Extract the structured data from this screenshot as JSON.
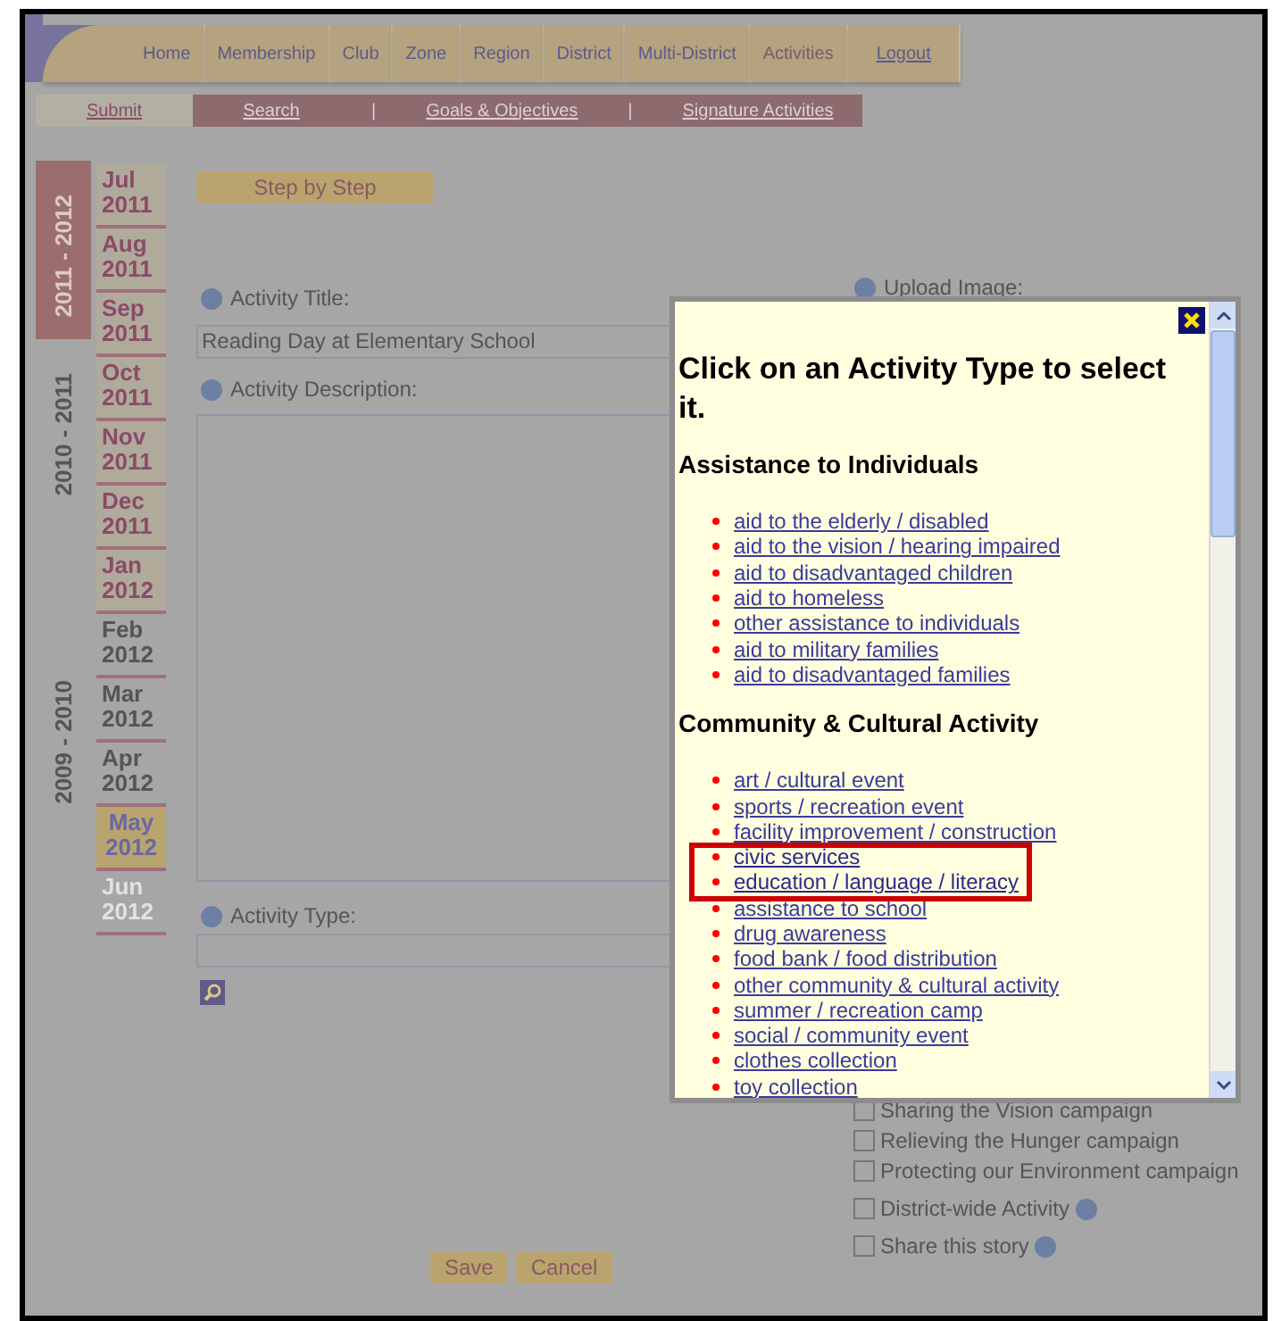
{
  "nav": {
    "items": [
      {
        "label": "Home",
        "selected": false,
        "kind": "tab"
      },
      {
        "label": "Membership",
        "selected": false,
        "kind": "tab"
      },
      {
        "label": "Club",
        "selected": false,
        "kind": "tab"
      },
      {
        "label": "Zone",
        "selected": false,
        "kind": "tab"
      },
      {
        "label": "Region",
        "selected": false,
        "kind": "tab"
      },
      {
        "label": "District",
        "selected": false,
        "kind": "tab"
      },
      {
        "label": "Multi-District",
        "selected": false,
        "kind": "tab"
      },
      {
        "label": "Activities",
        "selected": true,
        "kind": "tab"
      },
      {
        "label": "Logout",
        "selected": false,
        "kind": "link"
      }
    ]
  },
  "subnav": {
    "separators": [
      "|",
      "|"
    ],
    "items": [
      {
        "label": "Submit",
        "selected": true
      },
      {
        "label": "Search",
        "selected": false
      },
      {
        "label": "Goals & Objectives",
        "selected": false
      },
      {
        "label": "Signature Activities",
        "selected": false
      }
    ]
  },
  "years": [
    {
      "label": "2011 - 2012",
      "selected": true
    },
    {
      "label": "2010 - 2011",
      "selected": false
    },
    {
      "label": "2009 - 2010",
      "selected": false
    }
  ],
  "months": [
    {
      "month": "Jul",
      "year": "2011",
      "kind": "reported",
      "selected": false
    },
    {
      "month": "Aug",
      "year": "2011",
      "kind": "reported",
      "selected": false
    },
    {
      "month": "Sep",
      "year": "2011",
      "kind": "reported",
      "selected": false
    },
    {
      "month": "Oct",
      "year": "2011",
      "kind": "reported",
      "selected": false
    },
    {
      "month": "Nov",
      "year": "2011",
      "kind": "reported",
      "selected": false
    },
    {
      "month": "Dec",
      "year": "2011",
      "kind": "reported",
      "selected": false
    },
    {
      "month": "Jan",
      "year": "2012",
      "kind": "reported",
      "selected": false
    },
    {
      "month": "Feb",
      "year": "2012",
      "kind": "open",
      "selected": false
    },
    {
      "month": "Mar",
      "year": "2012",
      "kind": "open",
      "selected": false
    },
    {
      "month": "Apr",
      "year": "2012",
      "kind": "open",
      "selected": false
    },
    {
      "month": "May",
      "year": "2012",
      "kind": "open",
      "selected": true
    },
    {
      "month": "Jun",
      "year": "2012",
      "kind": "future",
      "selected": false
    }
  ],
  "form": {
    "step_button": "Step by Step",
    "title": {
      "label": "Activity Title:",
      "value": "Reading Day at Elementary School"
    },
    "description": {
      "label": "Activity Description:"
    },
    "activity_type": {
      "label": "Activity Type:"
    },
    "upload_image": {
      "label": "Upload Image:"
    },
    "checkboxes": [
      {
        "label": "Sharing the Vision campaign",
        "checked": false
      },
      {
        "label": "Relieving the Hunger campaign",
        "checked": false
      },
      {
        "label": "Protecting our Environment campaign",
        "checked": false
      },
      {
        "label": "District-wide Activity",
        "checked": false,
        "help": true
      },
      {
        "label": "Share this story",
        "checked": false,
        "help": true
      }
    ],
    "buttons": [
      "Save",
      "Cancel"
    ]
  },
  "popup": {
    "heading": "Click on an Activity Type to select it.",
    "sections": [
      {
        "title": "Assistance to Individuals",
        "items": [
          {
            "label": "aid to the elderly / disabled",
            "highlighted": false
          },
          {
            "label": "aid to the vision / hearing impaired",
            "highlighted": false
          },
          {
            "label": "aid to disadvantaged children",
            "highlighted": false
          },
          {
            "label": "aid to homeless",
            "highlighted": false
          },
          {
            "label": "other assistance to individuals",
            "highlighted": false
          },
          {
            "label": "aid to military families",
            "highlighted": false
          },
          {
            "label": "aid to disadvantaged families",
            "highlighted": false
          }
        ]
      },
      {
        "title": "Community & Cultural Activity",
        "items": [
          {
            "label": "art / cultural event",
            "highlighted": false
          },
          {
            "label": "sports / recreation event",
            "highlighted": false
          },
          {
            "label": "facility improvement / construction",
            "highlighted": false
          },
          {
            "label": "civic services",
            "highlighted": true
          },
          {
            "label": "education / language / literacy",
            "highlighted": true
          },
          {
            "label": "assistance to school",
            "highlighted": false
          },
          {
            "label": "drug awareness",
            "highlighted": false
          },
          {
            "label": "food bank / food distribution",
            "highlighted": false
          },
          {
            "label": "other community & cultural activity",
            "highlighted": false
          },
          {
            "label": "summer / recreation camp",
            "highlighted": false
          },
          {
            "label": "social / community event",
            "highlighted": false
          },
          {
            "label": "clothes collection",
            "highlighted": false
          },
          {
            "label": "toy collection",
            "highlighted": false
          }
        ]
      }
    ]
  }
}
